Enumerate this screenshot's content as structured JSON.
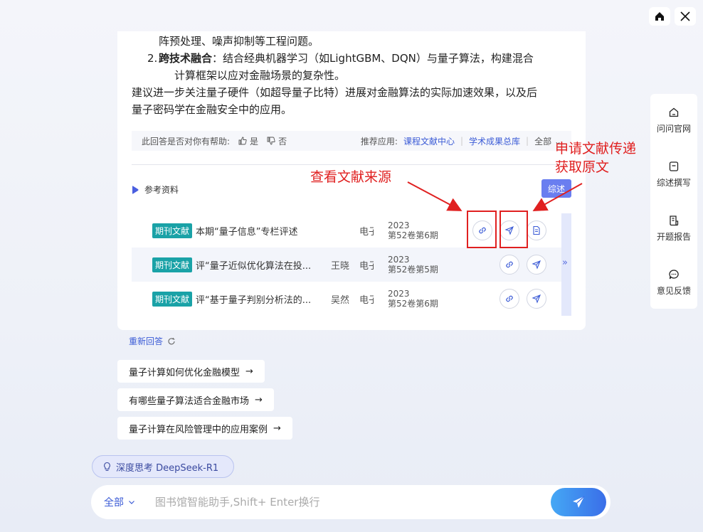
{
  "window": {
    "home_label": "home",
    "close_label": "close"
  },
  "answer": {
    "line_prev": "阵预处理、噪声抑制等工程问题。",
    "item2_num": "2.",
    "item2_bold": "跨技术融合",
    "item2_text": "：结合经典机器学习（如LightGBM、DQN）与量子算法，构建混合",
    "item2_text2": "计算框架以应对金融场景的复杂性。",
    "para1": "建议进一步关注量子硬件（如超导量子比特）进展对金融算法的实际加速效果，以及后",
    "para2": "量子密码学在金融安全中的应用。"
  },
  "feedback": {
    "question": "此回答是否对你有帮助:",
    "yes": "是",
    "no": "否",
    "recommend": "推荐应用:",
    "app1": "课程文献中心",
    "app2": "学术成果总库",
    "all": "全部"
  },
  "references": {
    "title": "参考资料",
    "summary_btn": "综述",
    "rows": [
      {
        "tag": "期刊文献",
        "title": "本期“量子信息”专栏评述",
        "author": "",
        "source": "电子",
        "year": "2023",
        "issue": "第52卷第6期"
      },
      {
        "tag": "期刊文献",
        "title": "评“量子近似优化算法在投...",
        "author": "王晓",
        "source": "电子",
        "year": "2023",
        "issue": "第52卷第5期"
      },
      {
        "tag": "期刊文献",
        "title": "评“基于量子判别分析法的...",
        "author": "吴然",
        "source": "电子",
        "year": "2023",
        "issue": "第52卷第6期"
      }
    ]
  },
  "annotations": {
    "source": "查看文献来源",
    "request_line1": "申请文献传递",
    "request_line2": "获取原文"
  },
  "regen": "重新回答",
  "suggestions": [
    "量子计算如何优化金融模型",
    "有哪些量子算法适合金融市场",
    "量子计算在风险管理中的应用案例"
  ],
  "arrow_glyph": "→",
  "deep_think": "深度思考 DeepSeek-R1",
  "input": {
    "scope": "全部",
    "placeholder": "图书馆智能助手,Shift+ Enter换行"
  },
  "sidebar": {
    "items": [
      "问问官网",
      "综述撰写",
      "开题报告",
      "意见反馈"
    ]
  },
  "colors": {
    "accent": "#3b5bd6",
    "tag": "#1aa2a7",
    "annotation": "#e02020"
  }
}
